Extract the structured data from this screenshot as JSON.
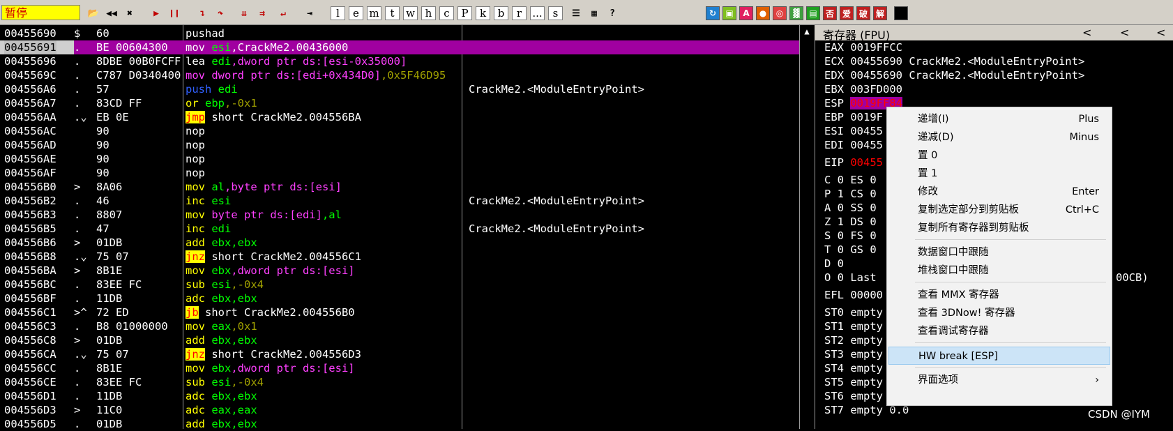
{
  "toolbar": {
    "status_label": "暂停",
    "letters": [
      "l",
      "e",
      "m",
      "t",
      "w",
      "h",
      "c",
      "P",
      "k",
      "b",
      "r",
      "...",
      "s"
    ],
    "color_buttons": [
      "A",
      "否",
      "爱",
      "破",
      "解"
    ]
  },
  "disasm": {
    "rows": [
      {
        "addr": "00455690",
        "arrow": "$",
        "bytes": "60",
        "asm": [
          {
            "t": "pushad",
            "c": "t-plain"
          }
        ],
        "comment": ""
      },
      {
        "addr": "00455691",
        "arrow": ".",
        "bytes": "BE 00604300",
        "asm": [
          {
            "t": "mov ",
            "c": "t-plain"
          },
          {
            "t": "esi",
            "c": "t-green"
          },
          {
            "t": ",CrackMe2.00436000",
            "c": "t-plain"
          }
        ],
        "comment": "",
        "sel": true
      },
      {
        "addr": "00455696",
        "arrow": ".",
        "bytes": "8DBE 00B0FCFF",
        "asm": [
          {
            "t": "lea ",
            "c": "t-plain"
          },
          {
            "t": "edi",
            "c": "t-green"
          },
          {
            "t": ",dword ptr ds:[esi-0x35000]",
            "c": "t-magenta"
          }
        ],
        "comment": ""
      },
      {
        "addr": "0045569C",
        "arrow": ".",
        "bytes": "C787 D0340400",
        "asm": [
          {
            "t": "mov ",
            "c": "t-magenta"
          },
          {
            "t": "dword ptr ds:[edi+0x434D0]",
            "c": "t-magenta"
          },
          {
            "t": ",0x5F46D95",
            "c": "t-olive"
          }
        ],
        "comment": ""
      },
      {
        "addr": "004556A6",
        "arrow": ".",
        "bytes": "57",
        "asm": [
          {
            "t": "push ",
            "c": "t-blue"
          },
          {
            "t": "edi",
            "c": "t-green"
          }
        ],
        "comment": "CrackMe2.<ModuleEntryPoint>"
      },
      {
        "addr": "004556A7",
        "arrow": ".",
        "bytes": "83CD FF",
        "asm": [
          {
            "t": "or ",
            "c": "t-yellow"
          },
          {
            "t": "ebp",
            "c": "t-green"
          },
          {
            "t": ",-0x1",
            "c": "t-olive"
          }
        ],
        "comment": ""
      },
      {
        "addr": "004556AA",
        "arrow": ".⌄",
        "bytes": "EB 0E",
        "asm": [
          {
            "t": "jmp",
            "c": "t-jmp"
          },
          {
            "t": " short CrackMe2.004556BA",
            "c": "t-plain"
          }
        ],
        "comment": ""
      },
      {
        "addr": "004556AC",
        "arrow": "",
        "bytes": "90",
        "asm": [
          {
            "t": "nop",
            "c": "t-plain"
          }
        ],
        "comment": ""
      },
      {
        "addr": "004556AD",
        "arrow": "",
        "bytes": "90",
        "asm": [
          {
            "t": "nop",
            "c": "t-plain"
          }
        ],
        "comment": ""
      },
      {
        "addr": "004556AE",
        "arrow": "",
        "bytes": "90",
        "asm": [
          {
            "t": "nop",
            "c": "t-plain"
          }
        ],
        "comment": ""
      },
      {
        "addr": "004556AF",
        "arrow": "",
        "bytes": "90",
        "asm": [
          {
            "t": "nop",
            "c": "t-plain"
          }
        ],
        "comment": ""
      },
      {
        "addr": "004556B0",
        "arrow": ">",
        "bytes": "8A06",
        "asm": [
          {
            "t": "mov ",
            "c": "t-yellow"
          },
          {
            "t": "al",
            "c": "t-green"
          },
          {
            "t": ",byte ptr ds:[esi]",
            "c": "t-magenta"
          }
        ],
        "comment": ""
      },
      {
        "addr": "004556B2",
        "arrow": ".",
        "bytes": "46",
        "asm": [
          {
            "t": "inc ",
            "c": "t-yellow"
          },
          {
            "t": "esi",
            "c": "t-green"
          }
        ],
        "comment": "CrackMe2.<ModuleEntryPoint>"
      },
      {
        "addr": "004556B3",
        "arrow": ".",
        "bytes": "8807",
        "asm": [
          {
            "t": "mov ",
            "c": "t-yellow"
          },
          {
            "t": "byte ptr ds:[edi]",
            "c": "t-magenta"
          },
          {
            "t": ",al",
            "c": "t-green"
          }
        ],
        "comment": ""
      },
      {
        "addr": "004556B5",
        "arrow": ".",
        "bytes": "47",
        "asm": [
          {
            "t": "inc ",
            "c": "t-yellow"
          },
          {
            "t": "edi",
            "c": "t-green"
          }
        ],
        "comment": "CrackMe2.<ModuleEntryPoint>"
      },
      {
        "addr": "004556B6",
        "arrow": ">",
        "bytes": "01DB",
        "asm": [
          {
            "t": "add ",
            "c": "t-yellow"
          },
          {
            "t": "ebx,ebx",
            "c": "t-green"
          }
        ],
        "comment": ""
      },
      {
        "addr": "004556B8",
        "arrow": ".⌄",
        "bytes": "75 07",
        "asm": [
          {
            "t": "jnz",
            "c": "t-jmp"
          },
          {
            "t": " short CrackMe2.004556C1",
            "c": "t-plain"
          }
        ],
        "comment": ""
      },
      {
        "addr": "004556BA",
        "arrow": ">",
        "bytes": "8B1E",
        "asm": [
          {
            "t": "mov ",
            "c": "t-yellow"
          },
          {
            "t": "ebx",
            "c": "t-green"
          },
          {
            "t": ",dword ptr ds:[esi]",
            "c": "t-magenta"
          }
        ],
        "comment": ""
      },
      {
        "addr": "004556BC",
        "arrow": ".",
        "bytes": "83EE FC",
        "asm": [
          {
            "t": "sub ",
            "c": "t-yellow"
          },
          {
            "t": "esi",
            "c": "t-green"
          },
          {
            "t": ",-0x4",
            "c": "t-olive"
          }
        ],
        "comment": ""
      },
      {
        "addr": "004556BF",
        "arrow": ".",
        "bytes": "11DB",
        "asm": [
          {
            "t": "adc ",
            "c": "t-yellow"
          },
          {
            "t": "ebx,ebx",
            "c": "t-green"
          }
        ],
        "comment": ""
      },
      {
        "addr": "004556C1",
        "arrow": ">^",
        "bytes": "72 ED",
        "asm": [
          {
            "t": "jb",
            "c": "t-jmp"
          },
          {
            "t": " short CrackMe2.004556B0",
            "c": "t-plain"
          }
        ],
        "comment": ""
      },
      {
        "addr": "004556C3",
        "arrow": ".",
        "bytes": "B8 01000000",
        "asm": [
          {
            "t": "mov ",
            "c": "t-yellow"
          },
          {
            "t": "eax",
            "c": "t-green"
          },
          {
            "t": ",0x1",
            "c": "t-olive"
          }
        ],
        "comment": ""
      },
      {
        "addr": "004556C8",
        "arrow": ">",
        "bytes": "01DB",
        "asm": [
          {
            "t": "add ",
            "c": "t-yellow"
          },
          {
            "t": "ebx,ebx",
            "c": "t-green"
          }
        ],
        "comment": ""
      },
      {
        "addr": "004556CA",
        "arrow": ".⌄",
        "bytes": "75 07",
        "asm": [
          {
            "t": "jnz",
            "c": "t-jmp"
          },
          {
            "t": " short CrackMe2.004556D3",
            "c": "t-plain"
          }
        ],
        "comment": ""
      },
      {
        "addr": "004556CC",
        "arrow": ".",
        "bytes": "8B1E",
        "asm": [
          {
            "t": "mov ",
            "c": "t-yellow"
          },
          {
            "t": "ebx",
            "c": "t-green"
          },
          {
            "t": ",dword ptr ds:[esi]",
            "c": "t-magenta"
          }
        ],
        "comment": ""
      },
      {
        "addr": "004556CE",
        "arrow": ".",
        "bytes": "83EE FC",
        "asm": [
          {
            "t": "sub ",
            "c": "t-yellow"
          },
          {
            "t": "esi",
            "c": "t-green"
          },
          {
            "t": ",-0x4",
            "c": "t-olive"
          }
        ],
        "comment": ""
      },
      {
        "addr": "004556D1",
        "arrow": ".",
        "bytes": "11DB",
        "asm": [
          {
            "t": "adc ",
            "c": "t-yellow"
          },
          {
            "t": "ebx,ebx",
            "c": "t-green"
          }
        ],
        "comment": ""
      },
      {
        "addr": "004556D3",
        "arrow": ">",
        "bytes": "11C0",
        "asm": [
          {
            "t": "adc ",
            "c": "t-yellow"
          },
          {
            "t": "eax,eax",
            "c": "t-green"
          }
        ],
        "comment": ""
      },
      {
        "addr": "004556D5",
        "arrow": ".",
        "bytes": "01DB",
        "asm": [
          {
            "t": "add ",
            "c": "t-yellow"
          },
          {
            "t": "ebx,ebx",
            "c": "t-green"
          }
        ],
        "comment": ""
      }
    ]
  },
  "registers": {
    "title": "寄存器 (FPU)",
    "nav": [
      "<",
      "<",
      "<"
    ],
    "lines": [
      {
        "text": "EAX 0019FFCC",
        "red": ""
      },
      {
        "text": "ECX 00455690 CrackMe2.<ModuleEntryPoint>",
        "red": ""
      },
      {
        "text": "EDX 00455690 CrackMe2.<ModuleEntryPoint>",
        "red": ""
      },
      {
        "text": "EBX 003FD000",
        "red": ""
      },
      {
        "text": "ESP ",
        "red": "0019FF84",
        "esp": true
      },
      {
        "text": "EBP 0019F",
        "red": ""
      },
      {
        "text": "ESI 00455",
        "red": ""
      },
      {
        "text": "EDI 00455",
        "red": ""
      },
      {
        "text": "EIP ",
        "red": "00455",
        "gap": true
      },
      {
        "text": "C 0  ES 0",
        "red": "",
        "gap": true
      },
      {
        "text": "P 1  CS 0",
        "red": ""
      },
      {
        "text": "A 0  SS 0",
        "red": ""
      },
      {
        "text": "Z 1  DS 0",
        "red": ""
      },
      {
        "text": "S 0  FS 0",
        "red": ""
      },
      {
        "text": "T 0  GS 0",
        "red": ""
      },
      {
        "text": "D 0",
        "red": ""
      },
      {
        "text": "O 0  Last",
        "red": "",
        "tail": "00CB)"
      },
      {
        "text": "EFL 00000",
        "red": "",
        "gap": true
      },
      {
        "text": "ST0 empty",
        "red": "",
        "gap": true
      },
      {
        "text": "ST1 empty",
        "red": ""
      },
      {
        "text": "ST2 empty",
        "red": ""
      },
      {
        "text": "ST3 empty",
        "red": ""
      },
      {
        "text": "ST4 empty",
        "red": ""
      },
      {
        "text": "ST5 empty",
        "red": ""
      },
      {
        "text": "ST6 empty 0.0",
        "red": ""
      },
      {
        "text": "ST7 empty 0.0",
        "red": ""
      }
    ]
  },
  "context_menu": {
    "items": [
      {
        "label": "递增(I)",
        "shortcut": "Plus"
      },
      {
        "label": "递减(D)",
        "shortcut": "Minus"
      },
      {
        "label": "置 0",
        "shortcut": ""
      },
      {
        "label": "置 1",
        "shortcut": ""
      },
      {
        "label": "修改",
        "shortcut": "Enter"
      },
      {
        "label": "复制选定部分到剪贴板",
        "shortcut": "Ctrl+C"
      },
      {
        "label": "复制所有寄存器到剪贴板",
        "shortcut": ""
      },
      {
        "sep": true
      },
      {
        "label": "数据窗口中跟随",
        "shortcut": ""
      },
      {
        "label": "堆栈窗口中跟随",
        "shortcut": ""
      },
      {
        "sep": true
      },
      {
        "label": "查看 MMX 寄存器",
        "shortcut": ""
      },
      {
        "label": "查看 3DNow! 寄存器",
        "shortcut": ""
      },
      {
        "label": "查看调试寄存器",
        "shortcut": ""
      },
      {
        "sep": true
      },
      {
        "label": "HW break [ESP]",
        "shortcut": "",
        "hl": true
      },
      {
        "sep": true
      },
      {
        "label": "界面选项",
        "shortcut": "",
        "submenu": true
      }
    ]
  },
  "watermark": "CSDN @IYM"
}
